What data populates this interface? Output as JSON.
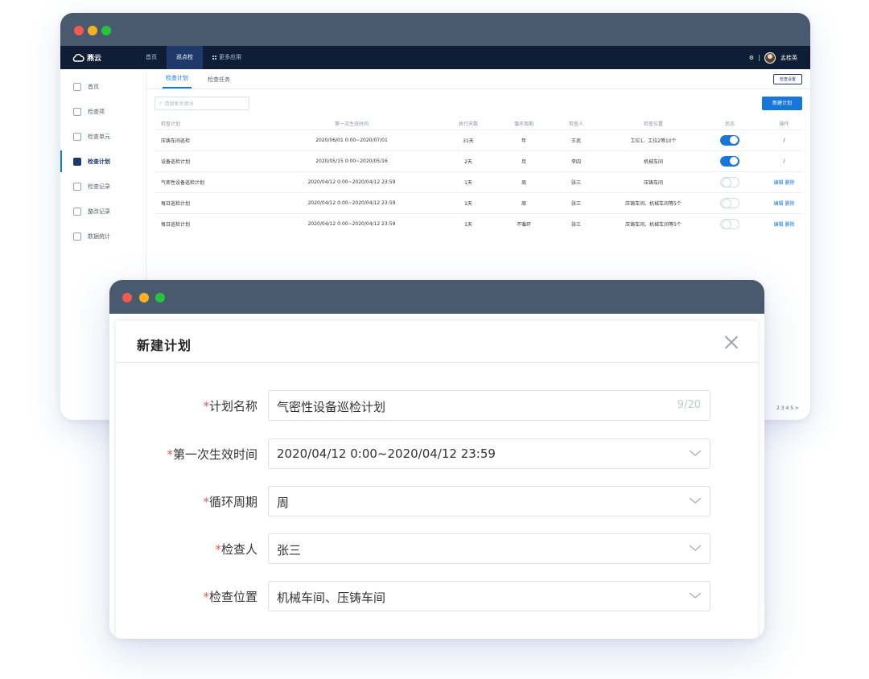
{
  "app": {
    "brand": "燕云",
    "nav": [
      "首页",
      "巡点检",
      "更多应用"
    ],
    "user_name": "孟桂英"
  },
  "sidebar": {
    "items": [
      {
        "label": "首页"
      },
      {
        "label": "检查项"
      },
      {
        "label": "检查单元"
      },
      {
        "label": "检查计划"
      },
      {
        "label": "检查记录"
      },
      {
        "label": "整改记录"
      },
      {
        "label": "数据统计"
      }
    ],
    "active_index": 3
  },
  "main": {
    "tabs": [
      "检查计划",
      "检查任务"
    ],
    "settings_button": "检查设置",
    "search_placeholder": "请搜索关键词",
    "new_button": "新建计划",
    "table": {
      "headers": [
        "检查计划",
        "第一次生效时间",
        "执行天数",
        "循环周期",
        "检查人",
        "检查位置",
        "状态",
        "操作"
      ],
      "rows": [
        {
          "name": "压铸车间巡检",
          "time": "2020/06/01 0:00~2020/07/01",
          "days": "31天",
          "cycle": "年",
          "person": "王武",
          "location": "工位1、工位2等10个",
          "status": "on",
          "ops": "/"
        },
        {
          "name": "设备巡检计划",
          "time": "2020/05/15 0:00~2020/05/16",
          "days": "2天",
          "cycle": "月",
          "person": "李四",
          "location": "机械车间",
          "status": "on",
          "ops": "/"
        },
        {
          "name": "气密性设备巡检计划",
          "time": "2020/04/12 0:00~2020/04/12 23:59",
          "days": "1天",
          "cycle": "周",
          "person": "张三",
          "location": "压铸车间",
          "status": "off",
          "ops": "编辑 删除"
        },
        {
          "name": "每日巡检计划",
          "time": "2020/04/12 0:00~2020/04/12 23:59",
          "days": "1天",
          "cycle": "周",
          "person": "张三",
          "location": "压铸车间、机械车间等5个",
          "status": "off",
          "ops": "编辑 删除"
        },
        {
          "name": "每日巡检计划",
          "time": "2020/04/12 0:00~2020/04/12 23:59",
          "days": "1天",
          "cycle": "不循环",
          "person": "张三",
          "location": "压铸车间、机械车间等5个",
          "status": "off",
          "ops": "编辑 删除"
        }
      ]
    },
    "pagination": "2 3 4 5 >"
  },
  "dialog": {
    "title": "新建计划",
    "fields": [
      {
        "label": "计划名称",
        "value": "气密性设备巡检计划",
        "count": "9/20"
      },
      {
        "label": "第一次生效时间",
        "value": "2020/04/12  0:00~2020/04/12  23:59"
      },
      {
        "label": "循环周期",
        "value": "周"
      },
      {
        "label": "检查人",
        "value": "张三"
      },
      {
        "label": "检查位置",
        "value": "机械车间、压铸车间"
      }
    ]
  },
  "colors": {
    "primary": "#1677d9",
    "navy": "#0f1e35",
    "chrome": "#4a5a6e",
    "required": "#e5584f"
  }
}
